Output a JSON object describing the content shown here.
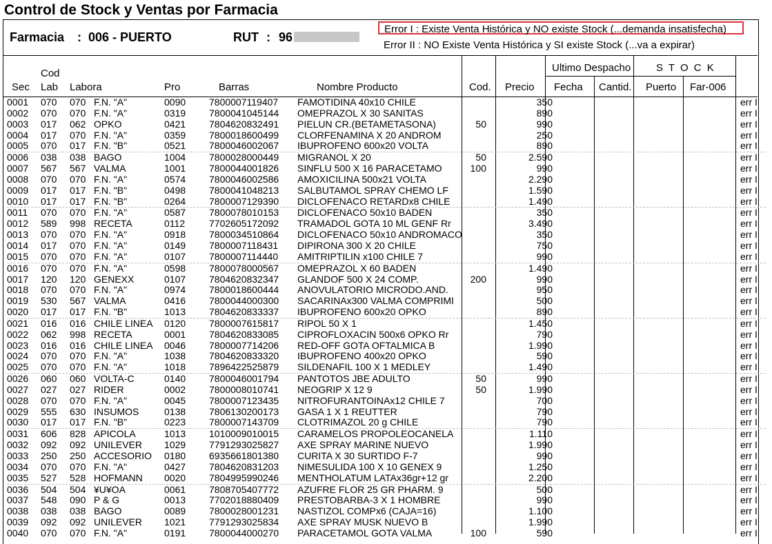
{
  "title": "Control de Stock y Ventas por Farmacia",
  "header": {
    "farmacia_label": "Farmacia",
    "farmacia_sep": ":",
    "farmacia_value": "006 - PUERTO",
    "rut_label": "RUT",
    "rut_sep": ":",
    "rut_value": "96"
  },
  "legend": {
    "error1": "Error I : Existe Venta Histórica y NO existe Stock (...demanda insatisfecha)",
    "error2": "Error II : NO Existe Venta Histórica y SI existe Stock (...va a expirar)"
  },
  "columns": {
    "sec": "Sec",
    "cod_lab_top": "Cod",
    "cod_lab_bottom": "Lab",
    "labora": "Labora",
    "pro": "Pro",
    "barras": "Barras",
    "nombre": "Nombre Producto",
    "cod": "Cod.",
    "precio": "Precio",
    "ultimo_despacho": "Ultimo Despacho",
    "fecha": "Fecha",
    "cantid": "Cantid.",
    "stock": "S T O C K",
    "puerto": "Puerto",
    "far006": "Far-006"
  },
  "rows": [
    {
      "sec": "0001",
      "lab": "070",
      "cod2": "070",
      "labora": "F.N. \"A\"",
      "pro": "0090",
      "barras": "7800007119407",
      "nombre": "FAMOTIDINA 40x10 CHILE",
      "cod": "",
      "precio": "350",
      "err": "err I"
    },
    {
      "sec": "0002",
      "lab": "070",
      "cod2": "070",
      "labora": "F.N. \"A\"",
      "pro": "0319",
      "barras": "7800041045144",
      "nombre": "OMEPRAZOL X 30 SANITAS",
      "cod": "",
      "precio": "890",
      "err": "err I"
    },
    {
      "sec": "0003",
      "lab": "017",
      "cod2": "062",
      "labora": "OPKO",
      "pro": "0421",
      "barras": "7804620832491",
      "nombre": "PIELUN CR.(BETAMETASONA)",
      "cod": "50",
      "precio": "990",
      "err": "err I"
    },
    {
      "sec": "0004",
      "lab": "017",
      "cod2": "070",
      "labora": "F.N. \"A\"",
      "pro": "0359",
      "barras": "7800018600499",
      "nombre": "CLORFENAMINA X 20 ANDROM",
      "cod": "",
      "precio": "250",
      "err": "err I"
    },
    {
      "sec": "0005",
      "lab": "070",
      "cod2": "017",
      "labora": "F.N. \"B\"",
      "pro": "0521",
      "barras": "7800046002067",
      "nombre": "IBUPROFENO 600x20 VOLTA",
      "cod": "",
      "precio": "890",
      "err": "err I"
    },
    {
      "sec": "0006",
      "lab": "038",
      "cod2": "038",
      "labora": "BAGO",
      "pro": "1004",
      "barras": "7800028000449",
      "nombre": "MIGRANOL X 20",
      "cod": "50",
      "precio": "2.590",
      "err": "err I"
    },
    {
      "sec": "0007",
      "lab": "567",
      "cod2": "567",
      "labora": "VALMA",
      "pro": "1001",
      "barras": "7800044001826",
      "nombre": "SINFLU 500 X 16 PARACETAMO",
      "cod": "100",
      "precio": "990",
      "err": "err I"
    },
    {
      "sec": "0008",
      "lab": "070",
      "cod2": "070",
      "labora": "F.N. \"A\"",
      "pro": "0574",
      "barras": "7800046002586",
      "nombre": "AMOXICILINA 500x21 VOLTA",
      "cod": "",
      "precio": "2.290",
      "err": "err I"
    },
    {
      "sec": "0009",
      "lab": "017",
      "cod2": "017",
      "labora": "F.N. \"B\"",
      "pro": "0498",
      "barras": "7800041048213",
      "nombre": "SALBUTAMOL SPRAY CHEMO LF",
      "cod": "",
      "precio": "1.590",
      "err": "err I"
    },
    {
      "sec": "0010",
      "lab": "017",
      "cod2": "017",
      "labora": "F.N. \"B\"",
      "pro": "0264",
      "barras": "7800007129390",
      "nombre": "DICLOFENACO RETARDx8 CHILE",
      "cod": "",
      "precio": "1.490",
      "err": "err I"
    },
    {
      "sec": "0011",
      "lab": "070",
      "cod2": "070",
      "labora": "F.N. \"A\"",
      "pro": "0587",
      "barras": "7800078010153",
      "nombre": "DICLOFENACO 50x10 BADEN",
      "cod": "",
      "precio": "350",
      "err": "err I"
    },
    {
      "sec": "0012",
      "lab": "589",
      "cod2": "998",
      "labora": "RECETA",
      "pro": "0112",
      "barras": "7702605172092",
      "nombre": "TRAMADOL GOTA 10 ML GENF Rr",
      "cod": "",
      "precio": "3.490",
      "err": "err I"
    },
    {
      "sec": "0013",
      "lab": "070",
      "cod2": "070",
      "labora": "F.N. \"A\"",
      "pro": "0918",
      "barras": "7800034510864",
      "nombre": "DICLOFENACO 50x10 ANDROMACO",
      "cod": "",
      "precio": "350",
      "err": "err I"
    },
    {
      "sec": "0014",
      "lab": "017",
      "cod2": "070",
      "labora": "F.N. \"A\"",
      "pro": "0149",
      "barras": "7800007118431",
      "nombre": "DIPIRONA 300 X 20 CHILE",
      "cod": "",
      "precio": "750",
      "err": "err I"
    },
    {
      "sec": "0015",
      "lab": "070",
      "cod2": "070",
      "labora": "F.N. \"A\"",
      "pro": "0107",
      "barras": "7800007114440",
      "nombre": "AMITRIPTILIN x100 CHILE  7",
      "cod": "",
      "precio": "990",
      "err": "err I"
    },
    {
      "sec": "0016",
      "lab": "070",
      "cod2": "070",
      "labora": "F.N. \"A\"",
      "pro": "0598",
      "barras": "7800078000567",
      "nombre": "OMEPRAZOL X 60 BADEN",
      "cod": "",
      "precio": "1.490",
      "err": "err I"
    },
    {
      "sec": "0017",
      "lab": "120",
      "cod2": "120",
      "labora": "GENEXX",
      "pro": "0107",
      "barras": "7804620832347",
      "nombre": "GLANDOF 500 X 24 COMP.",
      "cod": "200",
      "precio": "990",
      "err": "err I"
    },
    {
      "sec": "0018",
      "lab": "070",
      "cod2": "070",
      "labora": "F.N. \"A\"",
      "pro": "0974",
      "barras": "7800018600444",
      "nombre": "ANOVULATORIO MICRODO.AND.",
      "cod": "",
      "precio": "950",
      "err": "err I"
    },
    {
      "sec": "0019",
      "lab": "530",
      "cod2": "567",
      "labora": "VALMA",
      "pro": "0416",
      "barras": "7800044000300",
      "nombre": "SACARINAx300 VALMA COMPRIMI",
      "cod": "",
      "precio": "500",
      "err": "err I"
    },
    {
      "sec": "0020",
      "lab": "017",
      "cod2": "017",
      "labora": "F.N. \"B\"",
      "pro": "1013",
      "barras": "7804620833337",
      "nombre": "IBUPROFENO 600x20 OPKO",
      "cod": "",
      "precio": "890",
      "err": "err I"
    },
    {
      "sec": "0021",
      "lab": "016",
      "cod2": "016",
      "labora": "CHILE LINEA",
      "pro": "0120",
      "barras": "7800007615817",
      "nombre": "RIPOL  50 X 1",
      "cod": "",
      "precio": "1.450",
      "err": "err I"
    },
    {
      "sec": "0022",
      "lab": "062",
      "cod2": "998",
      "labora": "RECETA",
      "pro": "0001",
      "barras": "7804620833085",
      "nombre": "CIPROFLOXACIN 500x6 OPKO Rr",
      "cod": "",
      "precio": "790",
      "err": "err I"
    },
    {
      "sec": "0023",
      "lab": "016",
      "cod2": "016",
      "labora": "CHILE LINEA",
      "pro": "0046",
      "barras": "7800007714206",
      "nombre": "RED-OFF GOTA OFTALMICA    B",
      "cod": "",
      "precio": "1.990",
      "err": "err I"
    },
    {
      "sec": "0024",
      "lab": "070",
      "cod2": "070",
      "labora": "F.N. \"A\"",
      "pro": "1038",
      "barras": "7804620833320",
      "nombre": "IBUPROFENO 400x20 OPKO",
      "cod": "",
      "precio": "590",
      "err": "err I"
    },
    {
      "sec": "0025",
      "lab": "070",
      "cod2": "070",
      "labora": "F.N. \"A\"",
      "pro": "1018",
      "barras": "7896422525879",
      "nombre": "SILDENAFIL 100 X 1 MEDLEY",
      "cod": "",
      "precio": "1.490",
      "err": "err I"
    },
    {
      "sec": "0026",
      "lab": "060",
      "cod2": "060",
      "labora": "VOLTA-C",
      "pro": "0140",
      "barras": "7800046001794",
      "nombre": "PANTOTOS JBE ADULTO",
      "cod": "50",
      "precio": "990",
      "err": "err I"
    },
    {
      "sec": "0027",
      "lab": "027",
      "cod2": "027",
      "labora": "RIDER",
      "pro": "0002",
      "barras": "7800008010741",
      "nombre": "NEOGRIP X 12            9",
      "cod": "50",
      "precio": "1.990",
      "err": "err I"
    },
    {
      "sec": "0028",
      "lab": "070",
      "cod2": "070",
      "labora": "F.N. \"A\"",
      "pro": "0045",
      "barras": "7800007123435",
      "nombre": "NITROFURANTOINAx12 CHILE  7",
      "cod": "",
      "precio": "700",
      "err": "err I"
    },
    {
      "sec": "0029",
      "lab": "555",
      "cod2": "630",
      "labora": "INSUMOS",
      "pro": "0138",
      "barras": "7806130200173",
      "nombre": "GASA 1 X 1 REUTTER",
      "cod": "",
      "precio": "790",
      "err": "err I"
    },
    {
      "sec": "0030",
      "lab": "017",
      "cod2": "017",
      "labora": "F.N. \"B\"",
      "pro": "0223",
      "barras": "7800007143709",
      "nombre": "CLOTRIMAZOL 20 g CHILE",
      "cod": "",
      "precio": "790",
      "err": "err I"
    },
    {
      "sec": "0031",
      "lab": "606",
      "cod2": "828",
      "labora": "APICOLA",
      "pro": "1013",
      "barras": "1010009010015",
      "nombre": "CARAMELOS PROPOLEOCANELA",
      "cod": "",
      "precio": "1.110",
      "err": "err I"
    },
    {
      "sec": "0032",
      "lab": "092",
      "cod2": "092",
      "labora": "UNILEVER",
      "pro": "1029",
      "barras": "7791293025827",
      "nombre": "AXE SPRAY MARINE NUEVO",
      "cod": "",
      "precio": "1.990",
      "err": "err I"
    },
    {
      "sec": "0033",
      "lab": "250",
      "cod2": "250",
      "labora": "ACCESORIO",
      "pro": "0180",
      "barras": "6935661801380",
      "nombre": "CURITA X 30 SURTIDO F-7",
      "cod": "",
      "precio": "990",
      "err": "err I"
    },
    {
      "sec": "0034",
      "lab": "070",
      "cod2": "070",
      "labora": "F.N. \"A\"",
      "pro": "0427",
      "barras": "7804620831203",
      "nombre": "NIMESULIDA 100 X 10 GENEX 9",
      "cod": "",
      "precio": "1.250",
      "err": "err I"
    },
    {
      "sec": "0035",
      "lab": "527",
      "cod2": "528",
      "labora": "HOFMANN",
      "pro": "0020",
      "barras": "7804995990246",
      "nombre": "MENTHOLATUM LATAx36gr+12 gr",
      "cod": "",
      "precio": "2.200",
      "err": "err I"
    },
    {
      "sec": "0036",
      "lab": "504",
      "cod2": "504",
      "labora": "¥U¥OA",
      "pro": "0061",
      "barras": "7808705407772",
      "nombre": "AZUFRE FLOR 25 GR PHARM.  9",
      "cod": "",
      "precio": "500",
      "err": "err I"
    },
    {
      "sec": "0037",
      "lab": "548",
      "cod2": "090",
      "labora": "P & G",
      "pro": "0013",
      "barras": "7702018880409",
      "nombre": "PRESTOBARBA-3 X 1 HOMBRE",
      "cod": "",
      "precio": "990",
      "err": "err I"
    },
    {
      "sec": "0038",
      "lab": "038",
      "cod2": "038",
      "labora": "BAGO",
      "pro": "0089",
      "barras": "7800028001231",
      "nombre": "NASTIZOL COMPx6 (CAJA=16)",
      "cod": "",
      "precio": "1.100",
      "err": "err I"
    },
    {
      "sec": "0039",
      "lab": "092",
      "cod2": "092",
      "labora": "UNILEVER",
      "pro": "1021",
      "barras": "7791293025834",
      "nombre": "AXE SPRAY MUSK NUEVO  B",
      "cod": "",
      "precio": "1.990",
      "err": "err I"
    },
    {
      "sec": "0040",
      "lab": "070",
      "cod2": "070",
      "labora": "F.N. \"A\"",
      "pro": "0191",
      "barras": "7800044000270",
      "nombre": "PARACETAMOL GOTA VALMA",
      "cod": "100",
      "precio": "590",
      "err": "err I"
    }
  ]
}
